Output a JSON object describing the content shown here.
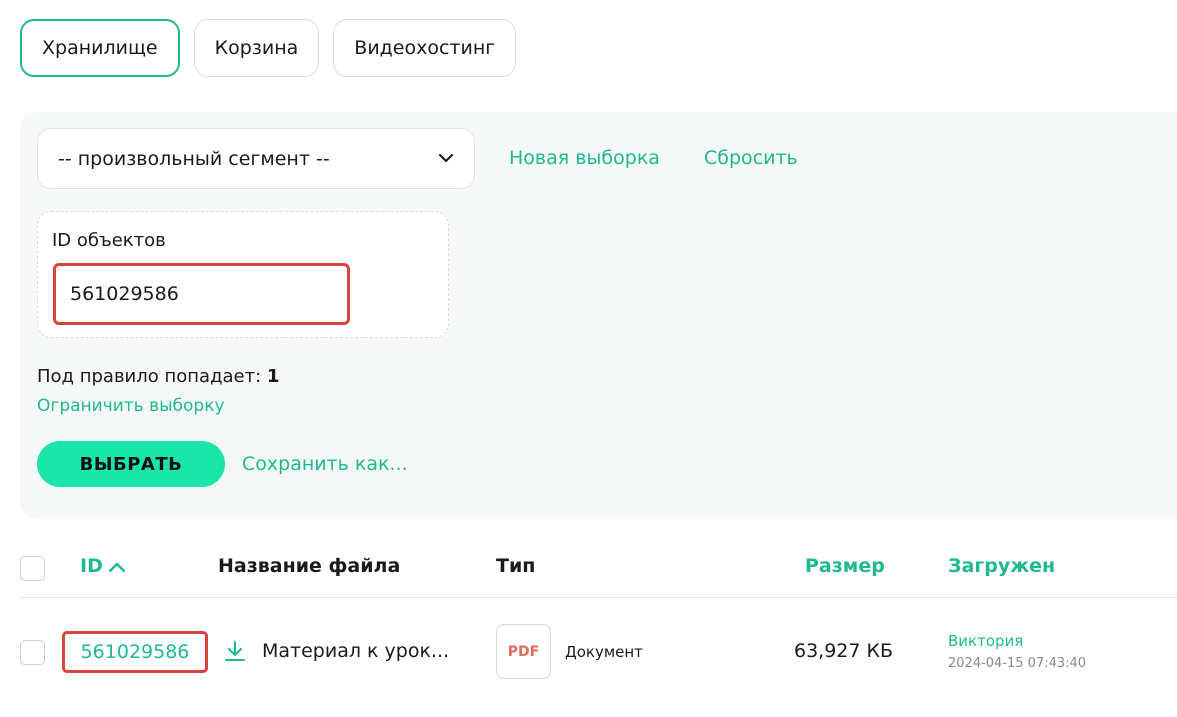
{
  "tabs": [
    {
      "label": "Хранилище",
      "active": true
    },
    {
      "label": "Корзина",
      "active": false
    },
    {
      "label": "Видеохостинг",
      "active": false
    }
  ],
  "filter": {
    "segment_value": "-- произвольный сегмент --",
    "new_selection": "Новая выборка",
    "reset": "Сбросить",
    "id_label": "ID объектов",
    "id_value": "561029586",
    "count_label": "Под правило попадает:",
    "count_value": "1",
    "limit_link": "Ограничить выборку",
    "select_button": "ВЫБРАТЬ",
    "save_as": "Сохранить как..."
  },
  "table": {
    "headers": {
      "id": "ID",
      "name": "Название файла",
      "type": "Тип",
      "size": "Размер",
      "uploaded": "Загружен"
    },
    "rows": [
      {
        "id": "561029586",
        "name": "Материал к урок...",
        "type_badge": "PDF",
        "type_label": "Документ",
        "size": "63,927 КБ",
        "uploader": "Виктория",
        "uploaded_at": "2024-04-15 07:43:40"
      }
    ]
  },
  "colors": {
    "accent": "#1fb98f",
    "button": "#19e6a8",
    "highlight": "#d9423d",
    "pdf": "#e26a5f"
  }
}
